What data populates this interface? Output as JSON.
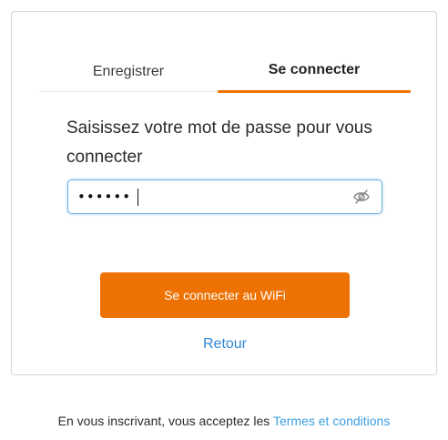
{
  "tabs": {
    "register_label": "Enregistrer",
    "login_label": "Se connecter",
    "active": "login"
  },
  "form": {
    "prompt": "Saisissez votre mot de passe pour vous connecter",
    "password_value": "••••••",
    "password_visibility_icon": "eye-off-icon",
    "submit_label": "Se connecter au WiFi",
    "back_label": "Retour"
  },
  "footer": {
    "text": "En vous inscrivant, vous acceptez les",
    "terms_link": "Termes et conditions"
  },
  "colors": {
    "accent": "#ee7203",
    "link": "#2f86d6",
    "focus_border": "#6aaee0"
  }
}
